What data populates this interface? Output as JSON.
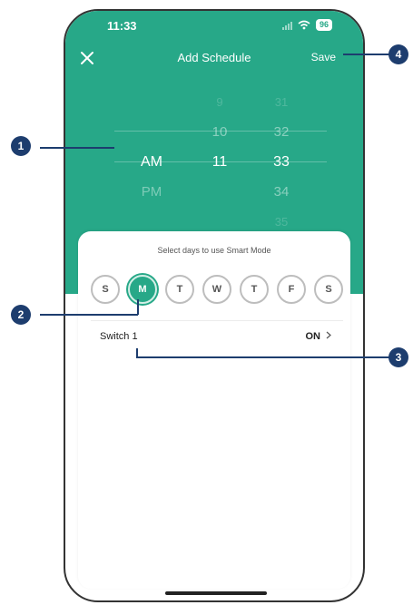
{
  "status": {
    "time": "11:33",
    "battery": "96"
  },
  "nav": {
    "title": "Add Schedule",
    "save_label": "Save"
  },
  "picker": {
    "ampm": [
      "AM",
      "PM"
    ],
    "hours": [
      "9",
      "10",
      "11"
    ],
    "minutes": [
      "31",
      "32",
      "33",
      "34",
      "35"
    ]
  },
  "schedule": {
    "prompt": "Select days to use Smart Mode",
    "days": [
      "S",
      "M",
      "T",
      "W",
      "T",
      "F",
      "S"
    ],
    "selected_day": "M"
  },
  "switch": {
    "label": "Switch 1",
    "value": "ON"
  },
  "callouts": [
    "1",
    "2",
    "3",
    "4"
  ],
  "colors": {
    "accent": "#27a888",
    "callout": "#1d3d6e"
  }
}
